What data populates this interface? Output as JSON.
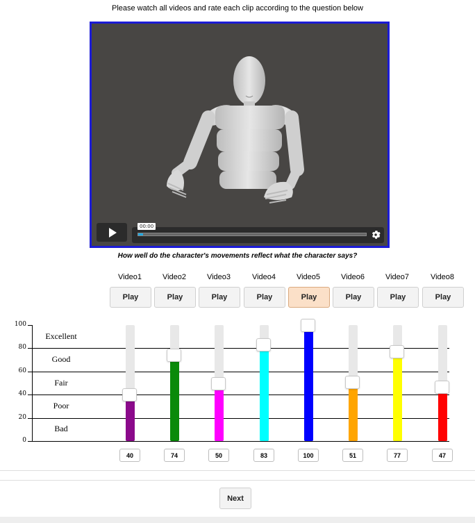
{
  "instructions": "Please watch all videos and rate each clip according to the question below",
  "player": {
    "timecode": "00:00",
    "progress_fraction": 0.02,
    "icons": {
      "play": "play-icon",
      "settings": "gear-icon"
    }
  },
  "question": "How well do the character's movements reflect what the character says?",
  "videos": [
    {
      "label": "Video1",
      "play_label": "Play",
      "value": "40",
      "color": "#8b0a8b"
    },
    {
      "label": "Video2",
      "play_label": "Play",
      "value": "74",
      "color": "#0a8a0a"
    },
    {
      "label": "Video3",
      "play_label": "Play",
      "value": "50",
      "color": "#ff00ff"
    },
    {
      "label": "Video4",
      "play_label": "Play",
      "value": "83",
      "color": "#00ffff"
    },
    {
      "label": "Video5",
      "play_label": "Play",
      "value": "100",
      "color": "#0000ff"
    },
    {
      "label": "Video6",
      "play_label": "Play",
      "value": "51",
      "color": "#ffa500"
    },
    {
      "label": "Video7",
      "play_label": "Play",
      "value": "77",
      "color": "#ffff00"
    },
    {
      "label": "Video8",
      "play_label": "Play",
      "value": "47",
      "color": "#ff0000"
    }
  ],
  "active_video_index": 4,
  "scale": {
    "ticks": [
      "100",
      "80",
      "60",
      "40",
      "20",
      "0"
    ],
    "ratings": [
      "Excellent",
      "Good",
      "Fair",
      "Poor",
      "Bad"
    ]
  },
  "next_label": "Next"
}
